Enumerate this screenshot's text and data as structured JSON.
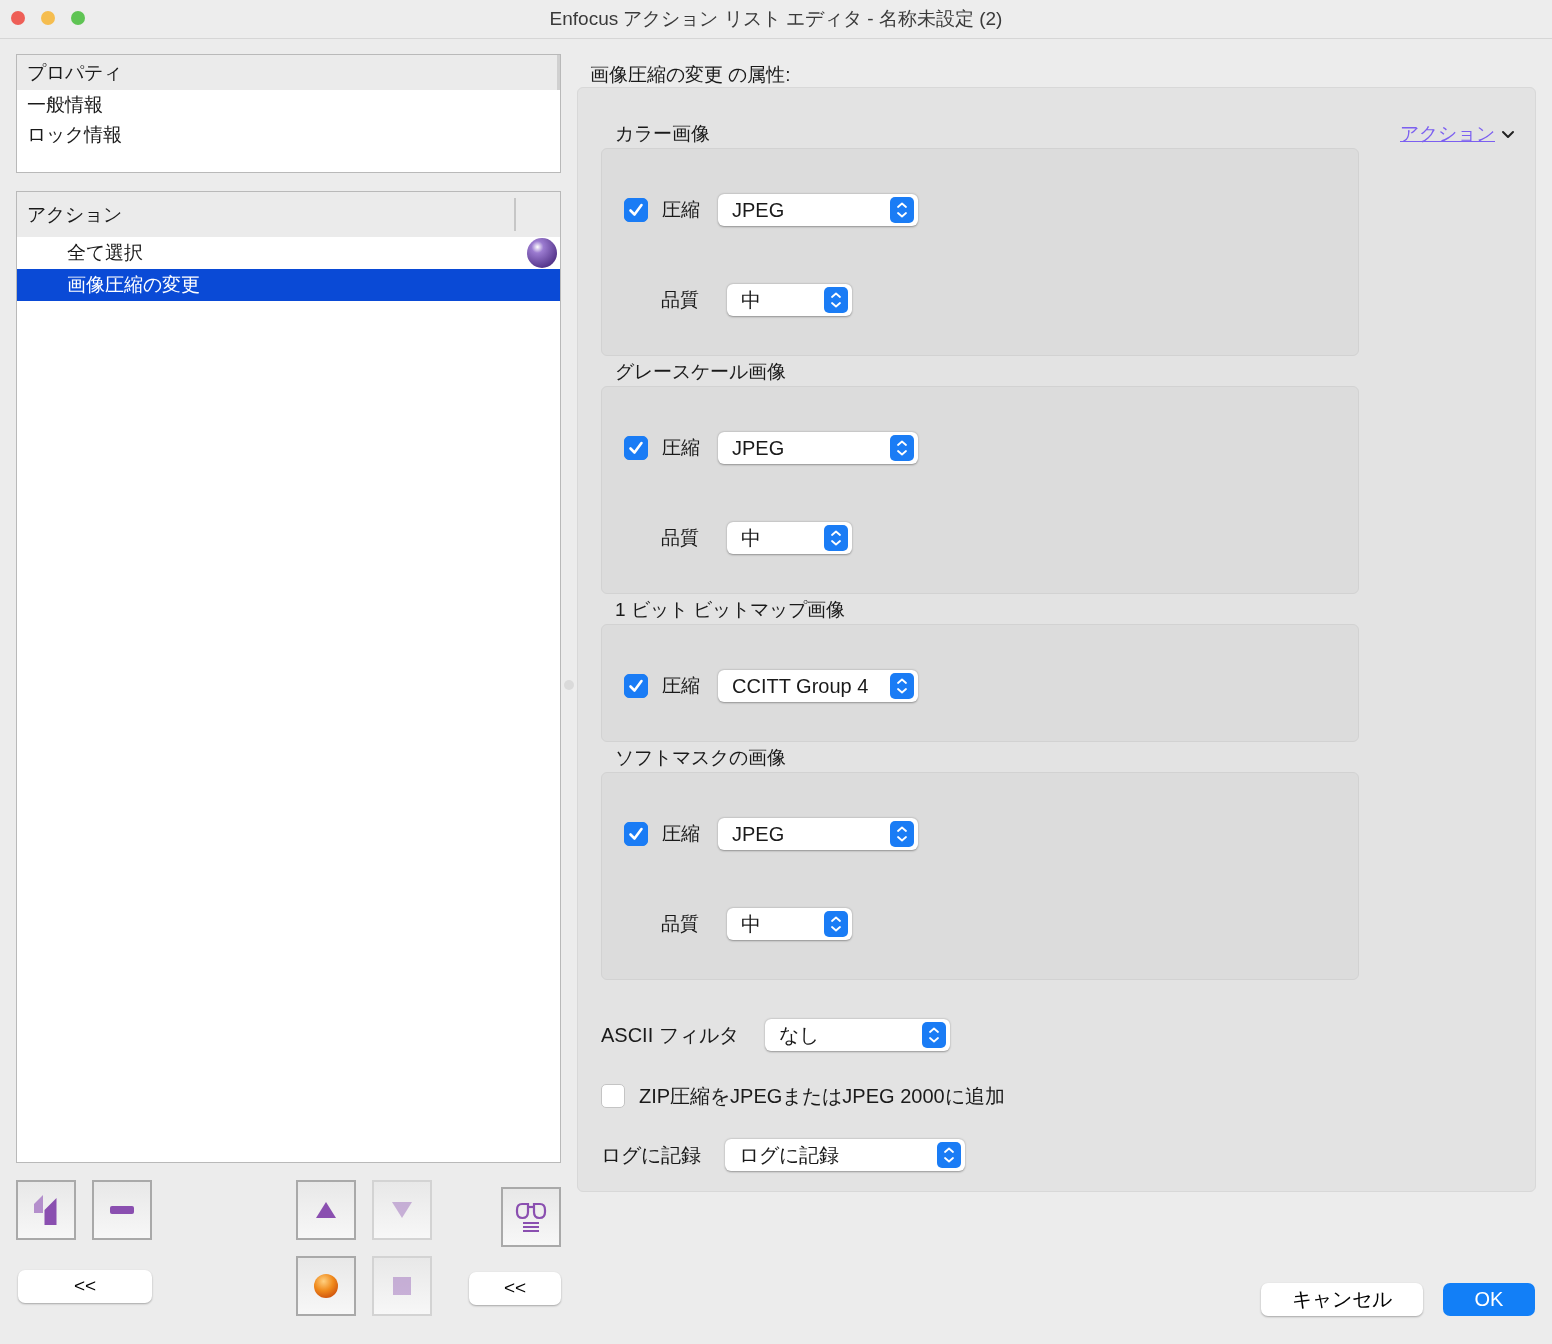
{
  "window": {
    "title": "Enfocus アクション リスト エディタ - 名称未設定 (2)"
  },
  "properties": {
    "header": "プロパティ",
    "items": [
      "一般情報",
      "ロック情報"
    ]
  },
  "actions": {
    "header": "アクション",
    "items": [
      {
        "label": "全て選択",
        "selected": false,
        "flagged": true
      },
      {
        "label": "画像圧縮の変更",
        "selected": true,
        "flagged": false
      }
    ]
  },
  "toolbar": [
    {
      "kind": "duplicate",
      "disabled": false
    },
    {
      "kind": "remove",
      "disabled": false
    },
    {
      "kind": "up",
      "disabled": false
    },
    {
      "kind": "down",
      "disabled": true
    },
    {
      "kind": "inspect",
      "disabled": false
    },
    {
      "kind": "record",
      "disabled": false
    },
    {
      "kind": "stop",
      "disabled": true
    }
  ],
  "left_collapse": "<<",
  "right_collapse": "<<",
  "attributes_heading": "画像圧縮の変更 の属性:",
  "action_menu": "アクション",
  "groups": [
    {
      "title": "カラー画像",
      "rows": [
        {
          "kind": "checkbox",
          "label": "圧縮",
          "checked": true,
          "value": "JPEG"
        },
        {
          "kind": "select",
          "label": "品質",
          "value": "中"
        }
      ]
    },
    {
      "title": "グレースケール画像",
      "rows": [
        {
          "kind": "checkbox",
          "label": "圧縮",
          "checked": true,
          "value": "JPEG"
        },
        {
          "kind": "select",
          "label": "品質",
          "value": "中"
        }
      ]
    },
    {
      "title": "1 ビット ビットマップ画像",
      "rows": [
        {
          "kind": "checkbox",
          "label": "圧縮",
          "checked": true,
          "value": "CCITT Group 4"
        }
      ]
    },
    {
      "title": "ソフトマスクの画像",
      "rows": [
        {
          "kind": "checkbox",
          "label": "圧縮",
          "checked": true,
          "value": "JPEG"
        },
        {
          "kind": "select",
          "label": "品質",
          "value": "中"
        }
      ]
    }
  ],
  "ascii_filter": {
    "label": "ASCII フィルタ",
    "value": "なし"
  },
  "zip_option": {
    "label": "ZIP圧縮をJPEGまたはJPEG 2000に追加",
    "checked": false
  },
  "log": {
    "label": "ログに記録",
    "value": "ログに記録"
  },
  "buttons": [
    {
      "label": "キャンセル",
      "kind": "cancel"
    },
    {
      "label": "OK",
      "kind": "default"
    }
  ]
}
